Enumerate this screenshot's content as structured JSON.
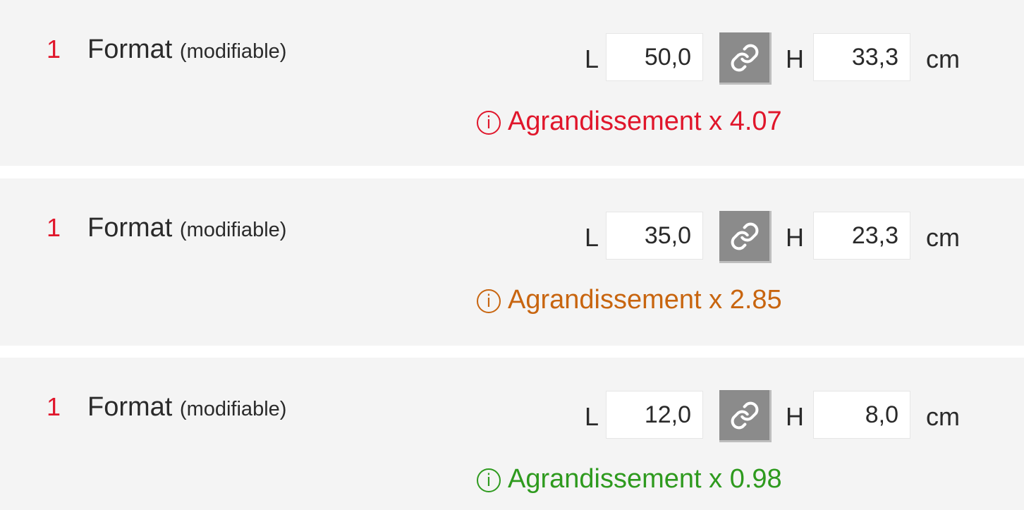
{
  "units": {
    "width_label": "L",
    "height_label": "H",
    "unit_label": "cm"
  },
  "rows": [
    {
      "step": "1",
      "title": "Format",
      "subtitle": "(modifiable)",
      "width": "50,0",
      "height": "33,3",
      "info_icon": "i",
      "notice": "Agrandissement x 4.07",
      "notice_color": "#e0162b"
    },
    {
      "step": "1",
      "title": "Format",
      "subtitle": "(modifiable)",
      "width": "35,0",
      "height": "23,3",
      "info_icon": "i",
      "notice": "Agrandissement x 2.85",
      "notice_color": "#c8650f"
    },
    {
      "step": "1",
      "title": "Format",
      "subtitle": "(modifiable)",
      "width": "12,0",
      "height": "8,0",
      "info_icon": "i",
      "notice": "Agrandissement x 0.98",
      "notice_color": "#2e9a1e"
    }
  ],
  "icons": {
    "link": "link-icon",
    "info": "info-circle-icon"
  }
}
